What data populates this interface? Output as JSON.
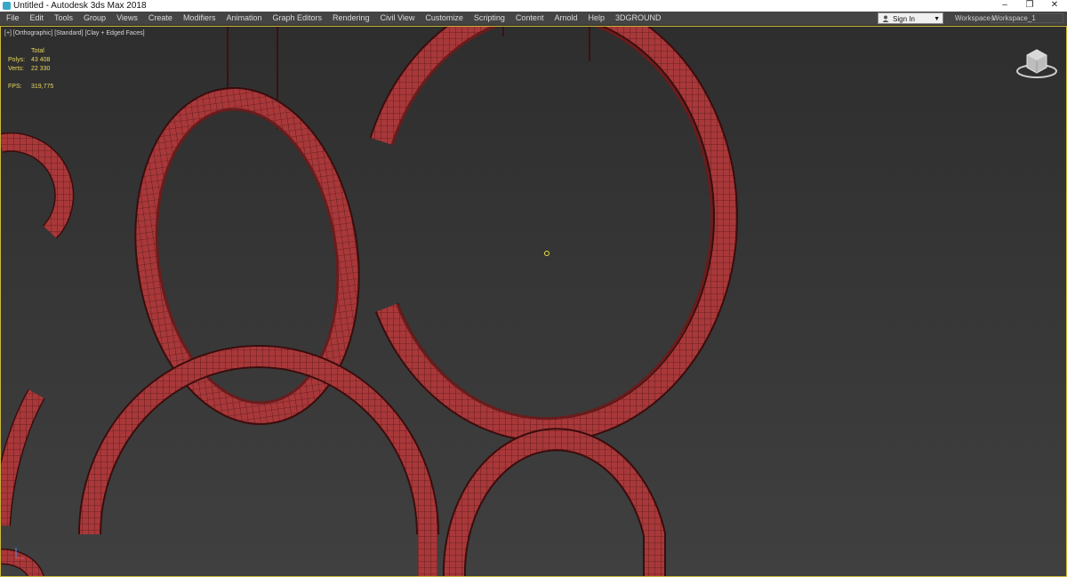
{
  "titlebar": {
    "title": "Untitled - Autodesk 3ds Max 2018",
    "minimize": "–",
    "restore": "❐",
    "close": "✕"
  },
  "menubar": {
    "items": [
      "File",
      "Edit",
      "Tools",
      "Group",
      "Views",
      "Create",
      "Modifiers",
      "Animation",
      "Graph Editors",
      "Rendering",
      "Civil View",
      "Customize",
      "Scripting",
      "Content",
      "Arnold",
      "Help",
      "3DGROUND"
    ],
    "signin_label": "Sign In",
    "workspaces_label": "Workspaces:",
    "workspace_value": "Workspace_1"
  },
  "viewport": {
    "label": "[+] [Orthographic] [Standard] [Clay + Edged Faces]",
    "stats": {
      "header": "Total",
      "polys_label": "Polys:",
      "polys_value": "43 408",
      "verts_label": "Verts:",
      "verts_value": "22 330",
      "fps_label": "FPS:",
      "fps_value": "319,775"
    }
  },
  "colors": {
    "ring_fill": "#a8383a",
    "ring_edge": "#3a0c0c",
    "stats_text": "#e8d860",
    "viewport_border": "#cdb83a"
  },
  "icons": {
    "app": "3ds-max-icon",
    "user": "user-icon",
    "viewcube": "viewcube-icon",
    "axis": "axis-tripod-icon"
  }
}
